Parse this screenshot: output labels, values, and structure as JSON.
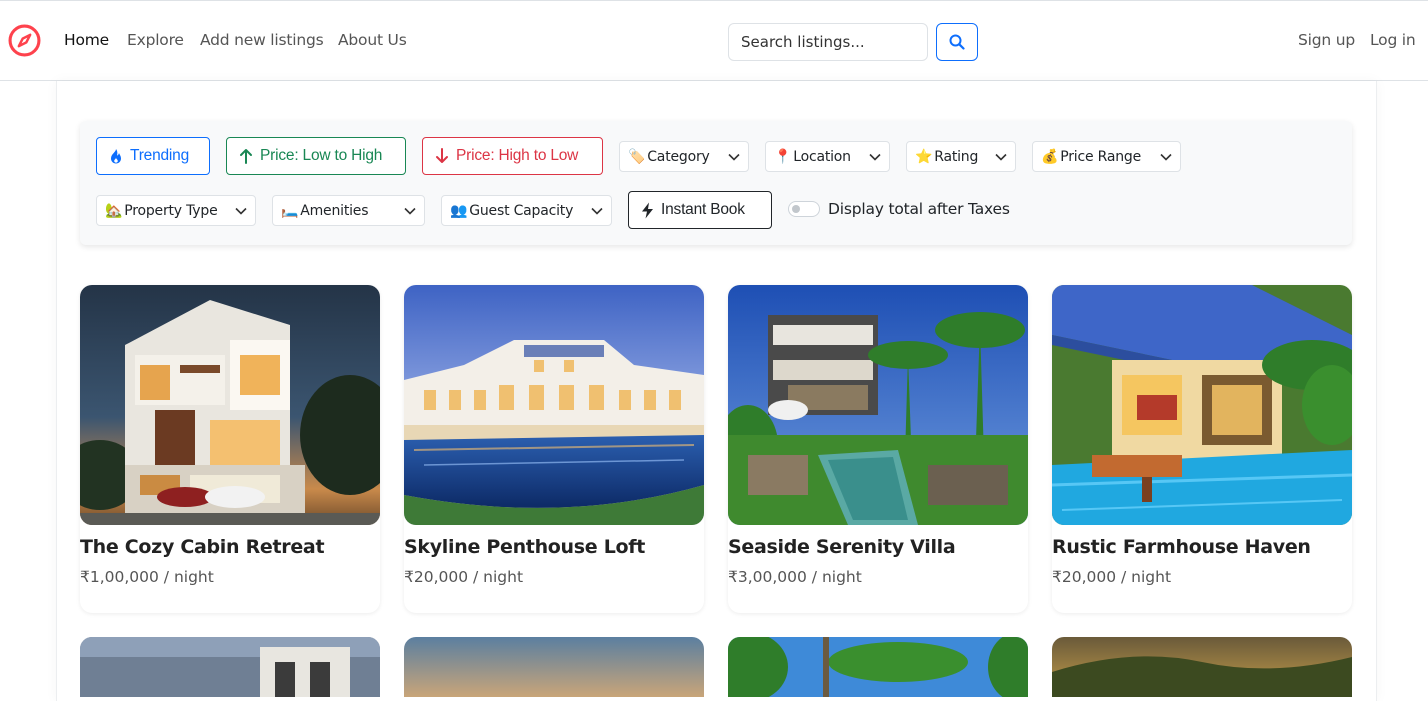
{
  "nav": {
    "links": [
      {
        "label": "Home"
      },
      {
        "label": "Explore"
      },
      {
        "label": "Add new listings"
      },
      {
        "label": "About Us"
      }
    ],
    "search_placeholder": "Search listings...",
    "auth": [
      {
        "label": "Sign up"
      },
      {
        "label": "Log in"
      }
    ],
    "brand_color": "#fe424d"
  },
  "filters": {
    "sort_buttons": [
      {
        "label": "Trending",
        "icon": "fire-icon",
        "color": "#0d6efd"
      },
      {
        "label": "Price: Low to High",
        "icon": "arrow-up-icon",
        "color": "#198754"
      },
      {
        "label": "Price: High to Low",
        "icon": "arrow-down-icon",
        "color": "#dc3545"
      }
    ],
    "dropdowns": [
      {
        "emoji": "🏷️",
        "label": "Category"
      },
      {
        "emoji": "📍",
        "label": "Location"
      },
      {
        "emoji": "⭐",
        "label": "Rating"
      },
      {
        "emoji": "💰",
        "label": "Price Range"
      },
      {
        "emoji": "🏡",
        "label": "Property Type"
      },
      {
        "emoji": "🛏️",
        "label": "Amenities"
      },
      {
        "emoji": "👥",
        "label": "Guest Capacity"
      }
    ],
    "instant_book": {
      "label": "Instant Book",
      "icon": "lightning-icon"
    },
    "tax_toggle": {
      "label": "Display total after Taxes",
      "on": false
    }
  },
  "listings": [
    {
      "title": "The Cozy Cabin Retreat",
      "price": "₹1,00,000 / night"
    },
    {
      "title": "Skyline Penthouse Loft",
      "price": "₹20,000 / night"
    },
    {
      "title": "Seaside Serenity Villa",
      "price": "₹3,00,000 / night"
    },
    {
      "title": "Rustic Farmhouse Haven",
      "price": "₹20,000 / night"
    }
  ]
}
